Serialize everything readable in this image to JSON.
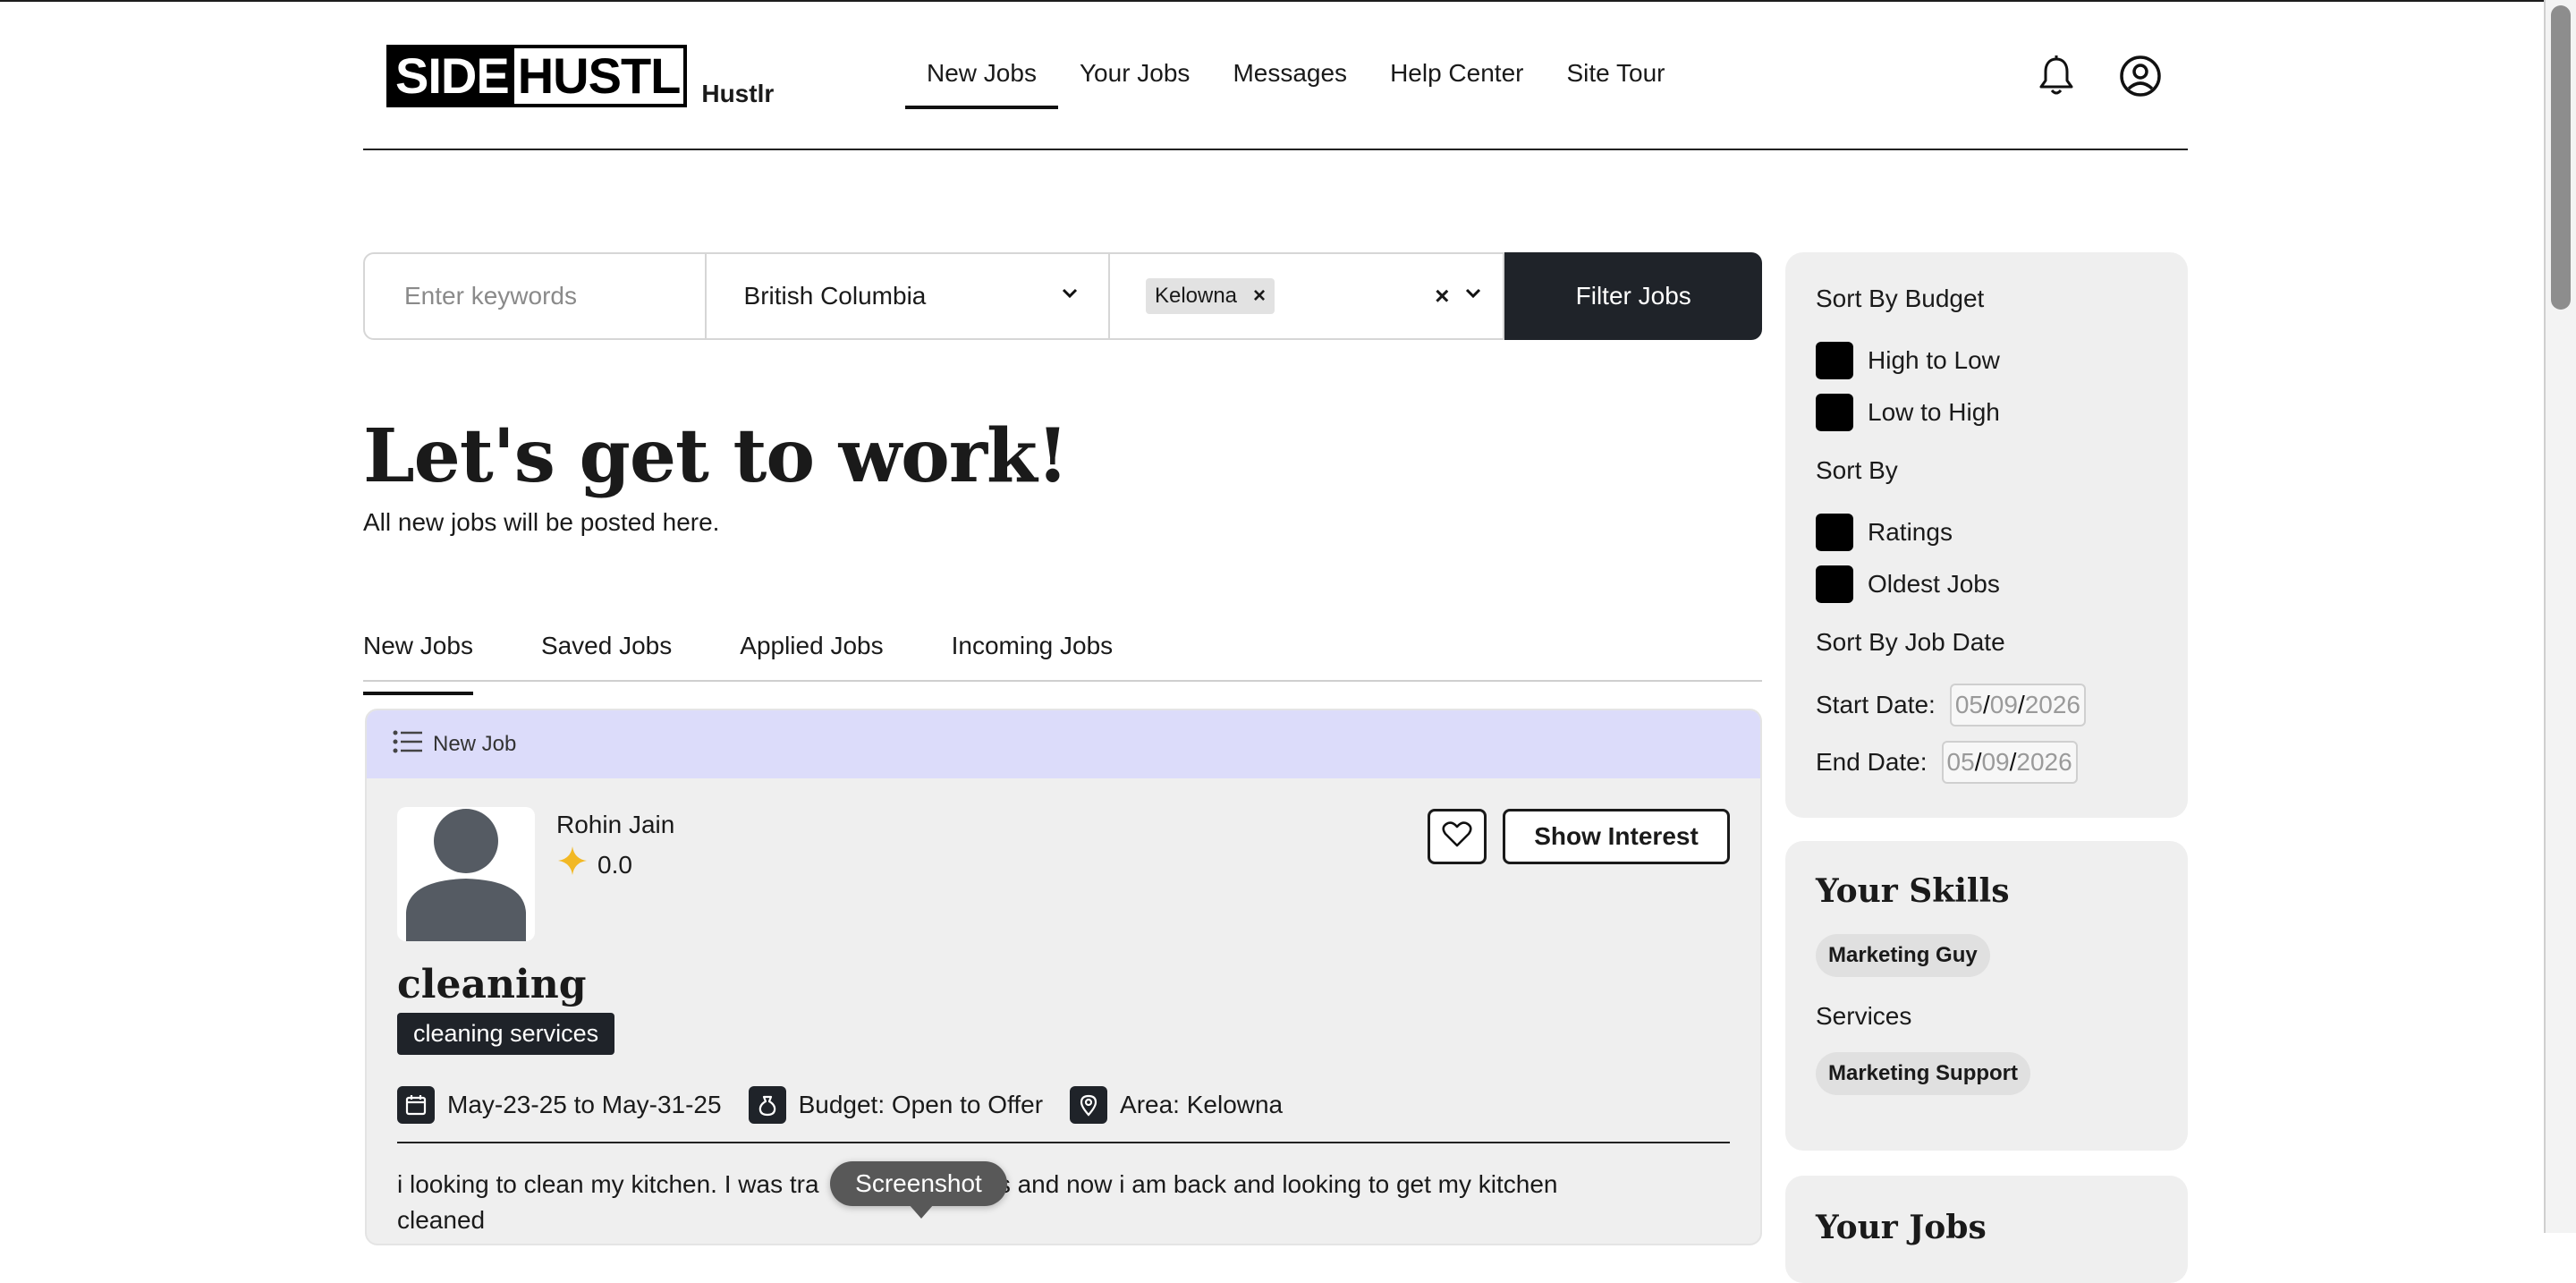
{
  "brand": {
    "logo_part1": "SIDE",
    "logo_part2": "HUSTL",
    "sub": "Hustlr"
  },
  "nav": {
    "items": [
      {
        "label": "New Jobs",
        "active": true
      },
      {
        "label": "Your Jobs"
      },
      {
        "label": "Messages"
      },
      {
        "label": "Help Center"
      },
      {
        "label": "Site Tour"
      }
    ]
  },
  "header_icons": {
    "notifications": "bell-icon",
    "profile": "user-circle-icon"
  },
  "filter": {
    "keywords_placeholder": "Enter keywords",
    "province": "British Columbia",
    "city_chip": "Kelowna",
    "chip_remove": "×",
    "clear": "×",
    "button": "Filter Jobs"
  },
  "hero": {
    "title": "Let's get to work!",
    "subtitle": "All new jobs will be posted here."
  },
  "tabs": [
    {
      "label": "New Jobs",
      "active": true
    },
    {
      "label": "Saved Jobs"
    },
    {
      "label": "Applied Jobs"
    },
    {
      "label": "Incoming Jobs"
    }
  ],
  "job": {
    "header": "New Job",
    "poster_name": "Rohin Jain",
    "rating": "0.0",
    "show_interest": "Show Interest",
    "title": "cleaning",
    "category": "cleaning services",
    "dates": "May-23-25 to May-31-25",
    "budget": "Budget: Open to Offer",
    "area": "Area: Kelowna",
    "description_start": "i looking to clean my kitchen. I was tra",
    "description_end": "t 4 weeks and now i am back and looking to get my kitchen",
    "description_line2": "cleaned"
  },
  "tooltip": "Screenshot",
  "sidebar": {
    "sort_budget_label": "Sort By Budget",
    "budget_options": [
      "High to Low",
      "Low to High"
    ],
    "sort_by_label": "Sort By",
    "sort_options": [
      "Ratings",
      "Oldest Jobs"
    ],
    "sort_date_label": "Sort By Job Date",
    "start_label": "Start Date:",
    "end_label": "End Date:",
    "date_parts": {
      "mm": "05",
      "dd": "09",
      "yyyy": "2026",
      "sep": "/"
    },
    "skills_title": "Your Skills",
    "skills": [
      "Marketing Guy"
    ],
    "services_label": "Services",
    "services": [
      "Marketing Support"
    ],
    "jobs_title": "Your Jobs"
  },
  "colors": {
    "accent_dark": "#1f2329",
    "card_header": "#dcdcfa",
    "star": "#f2b824"
  }
}
